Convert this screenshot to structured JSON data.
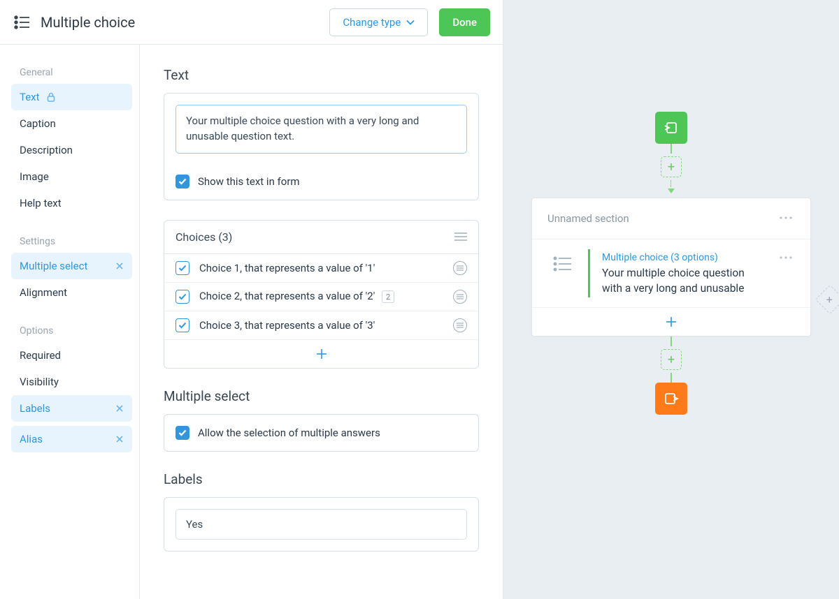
{
  "header": {
    "title": "Multiple choice",
    "change_type_label": "Change type",
    "done_label": "Done"
  },
  "sidebar": {
    "groups": [
      {
        "label": "General",
        "items": [
          {
            "key": "text",
            "label": "Text",
            "active": true,
            "locked": true
          },
          {
            "key": "caption",
            "label": "Caption"
          },
          {
            "key": "description",
            "label": "Description"
          },
          {
            "key": "image",
            "label": "Image"
          },
          {
            "key": "help",
            "label": "Help text"
          }
        ]
      },
      {
        "label": "Settings",
        "items": [
          {
            "key": "multiselect",
            "label": "Multiple select",
            "active": true,
            "removable": true
          },
          {
            "key": "alignment",
            "label": "Alignment"
          }
        ]
      },
      {
        "label": "Options",
        "items": [
          {
            "key": "required",
            "label": "Required"
          },
          {
            "key": "visibility",
            "label": "Visibility"
          },
          {
            "key": "labels",
            "label": "Labels",
            "active": true,
            "removable": true
          },
          {
            "key": "alias",
            "label": "Alias",
            "active": true,
            "removable": true
          }
        ]
      }
    ]
  },
  "text_section": {
    "title": "Text",
    "question_text": "Your multiple choice question with a very long and unusable question text.",
    "show_text_label": "Show this text in form",
    "show_text_checked": true
  },
  "choices_section": {
    "title": "Choices (3)",
    "items": [
      {
        "label": "Choice 1, that represents a value of '1'",
        "count": null
      },
      {
        "label": "Choice 2, that represents a value of '2'",
        "count": "2"
      },
      {
        "label": "Choice 3, that represents a value of '3'",
        "count": null
      }
    ]
  },
  "multiselect_section": {
    "title": "Multiple select",
    "allow_label": "Allow the selection of multiple answers",
    "allow_checked": true
  },
  "labels_section": {
    "title": "Labels",
    "value": "Yes"
  },
  "canvas": {
    "section_title": "Unnamed section",
    "block_kind": "Multiple choice (3 options)",
    "block_title": "Your multiple choice question with a very long and unusable"
  }
}
